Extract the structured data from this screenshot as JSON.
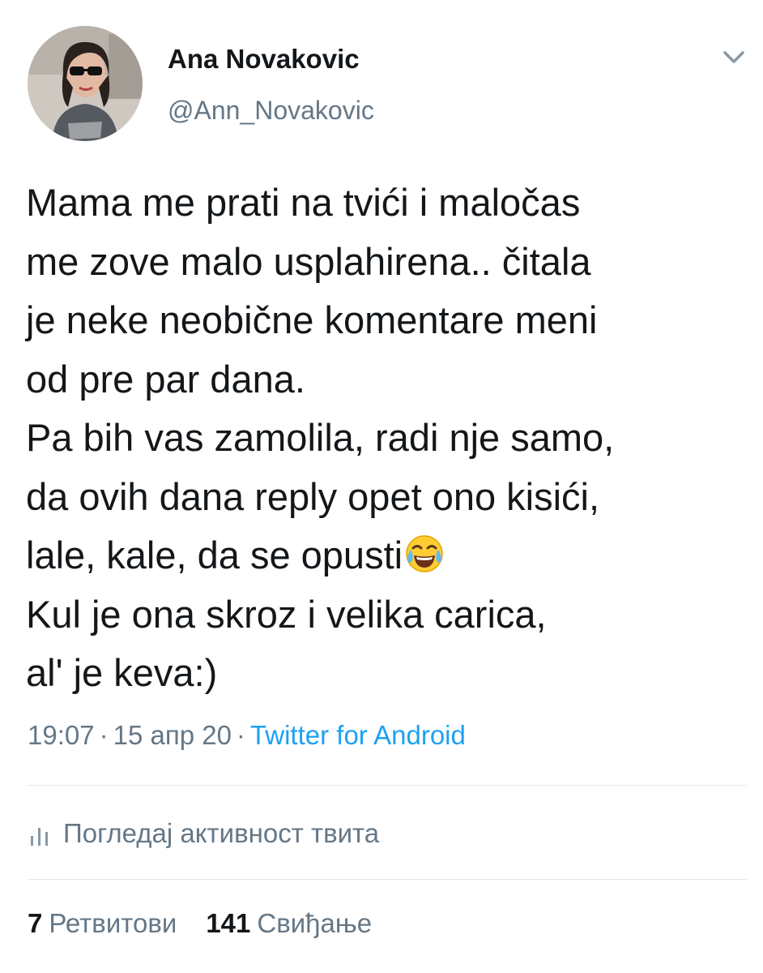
{
  "author": {
    "display_name": "Ana Novakovic",
    "handle": "@Ann_Novakovic",
    "avatar_icon": "profile-photo-avatar"
  },
  "caret_icon": "chevron-down-icon",
  "tweet": {
    "lines": [
      "Mama me prati na tvići i maločas",
      "me zove malo usplahirena.. čitala",
      "je neke neobične komentare meni",
      "od pre par dana.",
      "Pa bih vas zamolila, radi nje samo,",
      "da ovih dana reply opet ono kisići,",
      "lale, kale, da se opusti",
      "Kul je ona skroz i velika carica,",
      "al' je keva:)"
    ],
    "emoji_icon": "face-with-tears-of-joy-icon"
  },
  "meta": {
    "time": "19:07",
    "separator": "·",
    "date": "15 апр 20",
    "source": "Twitter for Android"
  },
  "activity": {
    "icon": "bar-chart-icon",
    "label": "Погледај активност твита"
  },
  "stats": {
    "retweets_count": "7",
    "retweets_label": "Ретвитови",
    "likes_count": "141",
    "likes_label": "Свиђање"
  },
  "colors": {
    "text": "#14171a",
    "secondary": "#657786",
    "link": "#1da1f2",
    "divider": "#e1e8ed"
  }
}
